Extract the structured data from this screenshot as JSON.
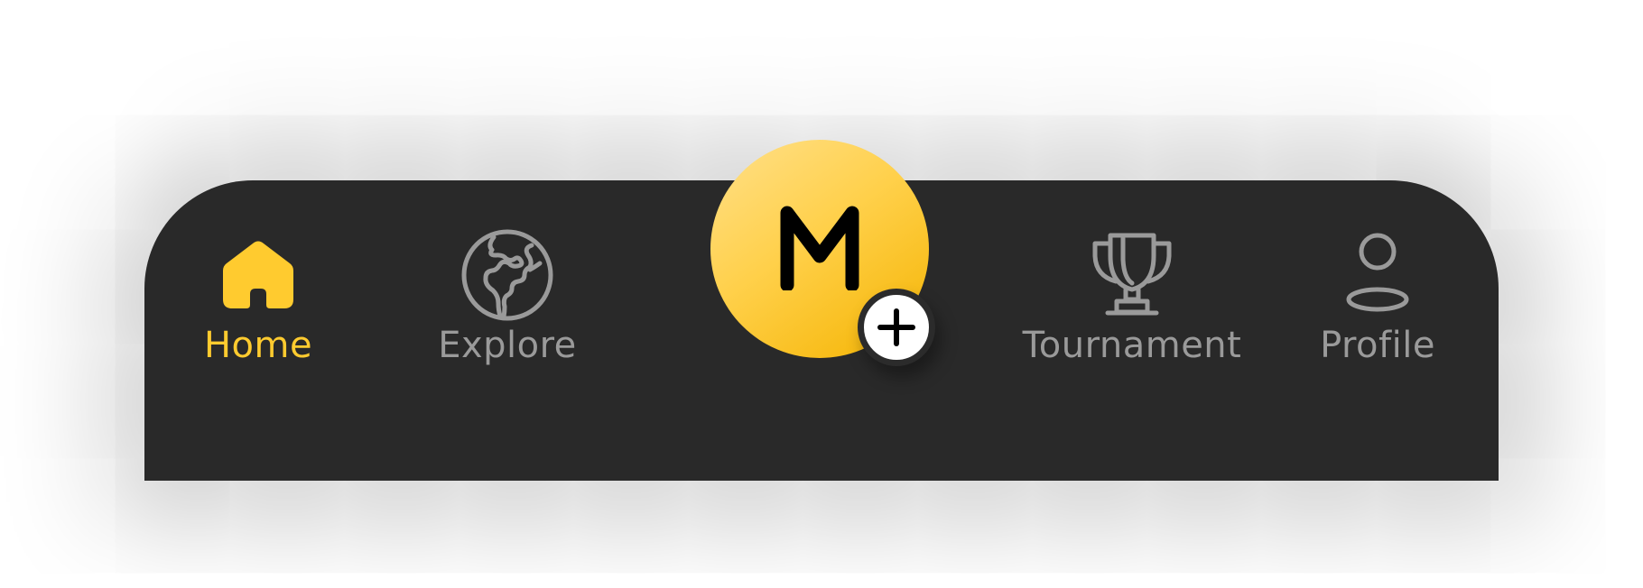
{
  "nav": {
    "items": [
      {
        "id": "home",
        "label": "Home",
        "icon": "home-icon",
        "active": true
      },
      {
        "id": "explore",
        "label": "Explore",
        "icon": "globe-icon",
        "active": false
      },
      {
        "id": "tournament",
        "label": "Tournament",
        "icon": "trophy-icon",
        "active": false
      },
      {
        "id": "profile",
        "label": "Profile",
        "icon": "user-icon",
        "active": false
      }
    ],
    "center": {
      "letter": "M",
      "badge_icon": "plus-icon"
    }
  },
  "colors": {
    "accent": "#FFCB2F",
    "bar_background": "#292929",
    "inactive": "#9a9a9a",
    "center_gradient_start": "#FFE08A",
    "center_gradient_end": "#F4B300"
  }
}
